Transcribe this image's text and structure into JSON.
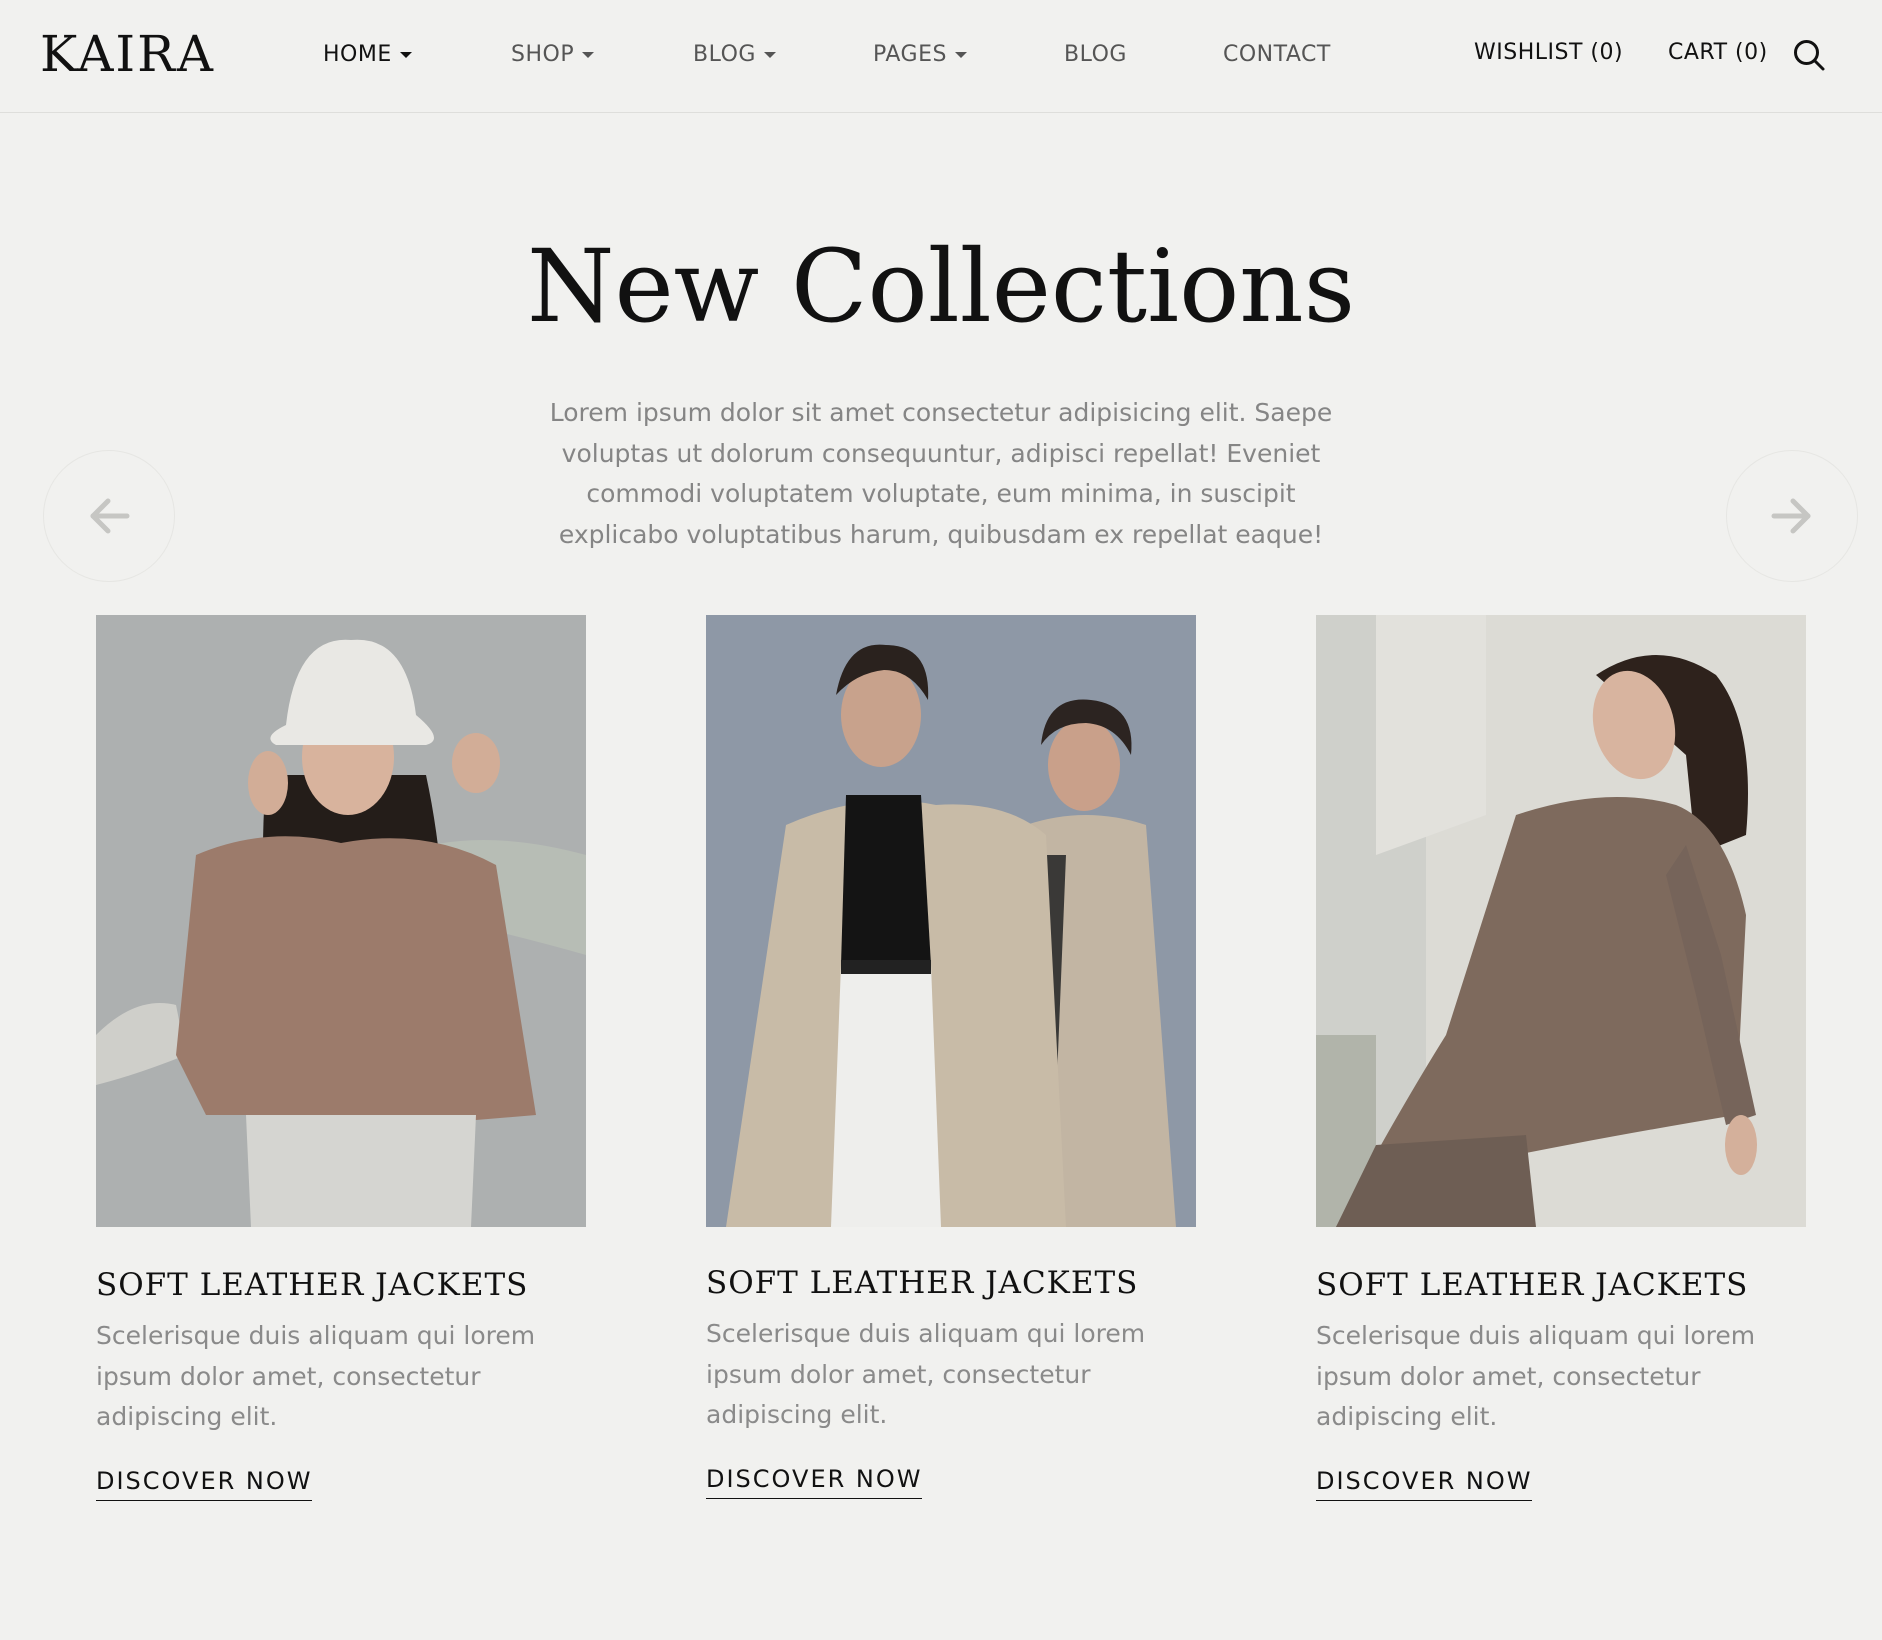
{
  "brand": "KAIRA",
  "nav": [
    {
      "label": "HOME",
      "has_dropdown": true,
      "active": true
    },
    {
      "label": "SHOP",
      "has_dropdown": true,
      "active": false
    },
    {
      "label": "BLOG",
      "has_dropdown": true,
      "active": false
    },
    {
      "label": "PAGES",
      "has_dropdown": true,
      "active": false
    },
    {
      "label": "BLOG",
      "has_dropdown": false,
      "active": false
    },
    {
      "label": "CONTACT",
      "has_dropdown": false,
      "active": false
    }
  ],
  "utility": {
    "wishlist": "WISHLIST (0)",
    "cart": "CART (0)",
    "search_icon": "search-icon"
  },
  "hero": {
    "title": "New Collections",
    "description": "Lorem ipsum dolor sit amet consectetur adipisicing elit. Saepe voluptas ut dolorum consequuntur, adipisci repellat! Eveniet commodi voluptatem voluptate, eum minima, in suscipit explicabo voluptatibus harum, quibusdam ex repellat eaque!"
  },
  "slider": {
    "prev_icon": "arrow-left-icon",
    "next_icon": "arrow-right-icon"
  },
  "cards": [
    {
      "title": "SOFT LEATHER JACKETS",
      "description": "Scelerisque duis aliquam qui lorem ipsum dolor amet, consectetur adipiscing elit.",
      "link": "DISCOVER NOW"
    },
    {
      "title": "SOFT LEATHER JACKETS",
      "description": "Scelerisque duis aliquam qui lorem ipsum dolor amet, consectetur adipiscing elit.",
      "link": "DISCOVER NOW"
    },
    {
      "title": "SOFT LEATHER JACKETS",
      "description": "Scelerisque duis aliquam qui lorem ipsum dolor amet, consectetur adipiscing elit.",
      "link": "DISCOVER NOW"
    }
  ],
  "colors": {
    "background": "#f1f1ef",
    "text_primary": "#111111",
    "text_muted": "#858585"
  }
}
